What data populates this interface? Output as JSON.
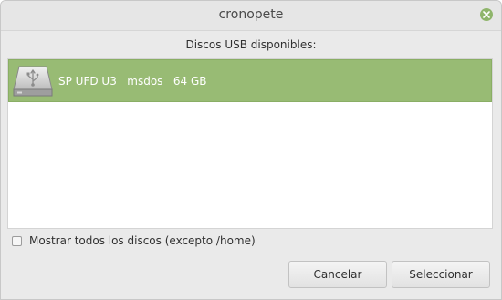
{
  "window": {
    "title": "cronopete"
  },
  "heading": "Discos USB disponibles:",
  "disks": [
    {
      "name": "SP UFD U3",
      "format": "msdos",
      "size": "64 GB",
      "label": "SP UFD U3   msdos   64 GB",
      "icon": "usb-drive-icon",
      "selected": true
    }
  ],
  "show_all_checkbox": {
    "label": "Mostrar todos los discos (excepto /home)",
    "checked": false
  },
  "buttons": {
    "cancel": "Cancelar",
    "select": "Seleccionar"
  },
  "colors": {
    "selection": "#98bb74",
    "close_button": "#8fb56b",
    "window_bg": "#eaeaea"
  }
}
